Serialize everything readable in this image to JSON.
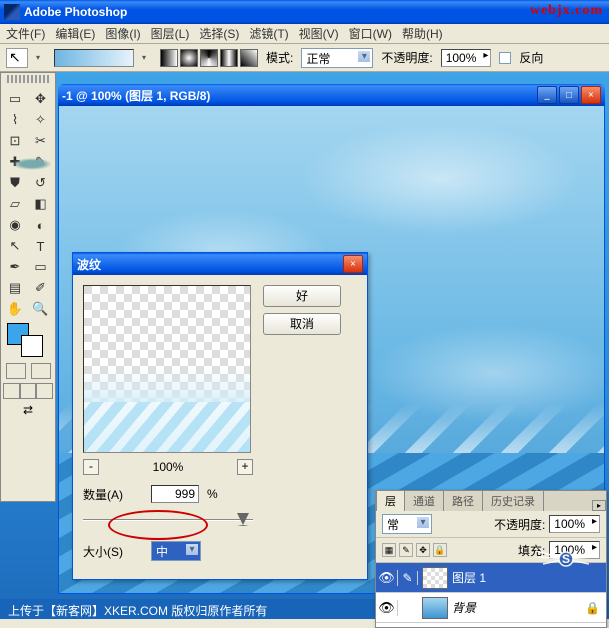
{
  "app": {
    "title": "Adobe Photoshop"
  },
  "watermark": "webjx.com",
  "menu": {
    "file": "文件(F)",
    "edit": "编辑(E)",
    "image": "图像(I)",
    "layer": "图层(L)",
    "select": "选择(S)",
    "filter": "滤镜(T)",
    "view": "视图(V)",
    "window": "窗口(W)",
    "help": "帮助(H)"
  },
  "options": {
    "mode_label": "模式:",
    "mode_value": "正常",
    "opacity_label": "不透明度:",
    "opacity_value": "100%",
    "reverse_label": "反向"
  },
  "doc": {
    "title": "-1 @ 100% (图层 1, RGB/8)"
  },
  "dialog": {
    "title": "波纹",
    "ok": "好",
    "cancel": "取消",
    "zoom": "100%",
    "amount_label": "数量(A)",
    "amount_value": "999",
    "amount_unit": "%",
    "size_label": "大小(S)",
    "size_value": "中"
  },
  "layers": {
    "tab_layers": "层",
    "tab_channels": "通道",
    "tab_paths": "路径",
    "tab_history": "历史记录",
    "blend": "常",
    "opacity_label": "不透明度:",
    "opacity_value": "100%",
    "lock_label": "",
    "fill_label": "填充:",
    "fill_value": "100%",
    "layer1": "图层 1",
    "bg": "背景"
  },
  "footer": "上传于【新客网】XKER.COM  版权归原作者所有"
}
